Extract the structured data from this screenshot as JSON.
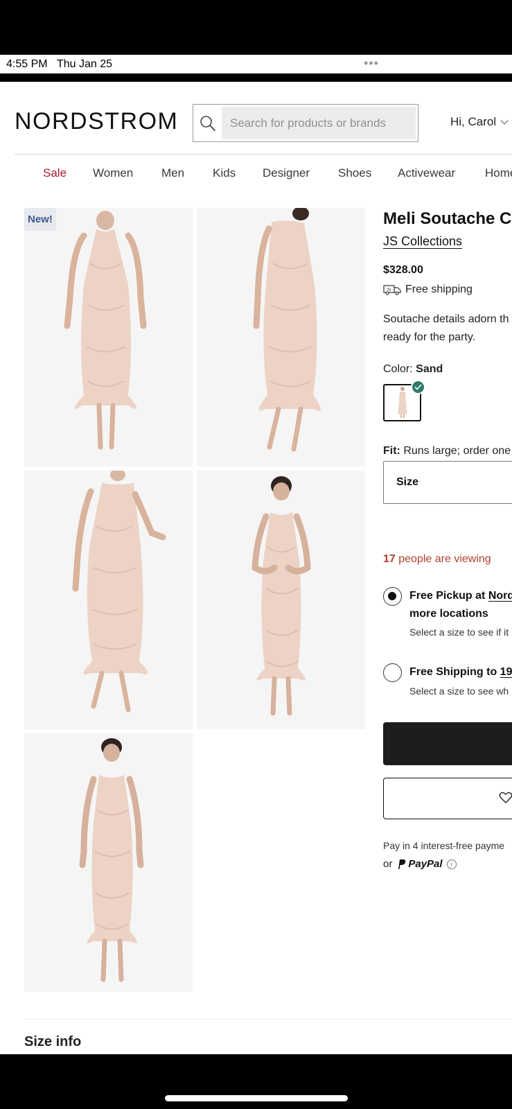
{
  "status_bar": {
    "time": "4:55 PM",
    "date": "Thu Jan 25",
    "dots": "•••"
  },
  "header": {
    "logo": "NORDSTROM",
    "search_placeholder": "Search for products or brands",
    "account_label": "Hi, Carol"
  },
  "nav": {
    "items": [
      "Sale",
      "Women",
      "Men",
      "Kids",
      "Designer",
      "Shoes",
      "Activewear",
      "Home"
    ]
  },
  "gallery": {
    "badge": "New!",
    "image_count": 5,
    "dress_color": "#ecd3c6"
  },
  "product": {
    "title": "Meli Soutache C",
    "brand": "JS Collections",
    "price": "$328.00",
    "shipping": "Free shipping",
    "description_line1": "Soutache details adorn th",
    "description_line2": "ready for the party.",
    "color_label": "Color:",
    "color_value": "Sand",
    "fit_label": "Fit:",
    "fit_value": "Runs large; order one",
    "size_label": "Size",
    "viewing_count": "17",
    "viewing_text": "people are viewing",
    "pickup_title_prefix": "Free Pickup at ",
    "pickup_store": "Nord",
    "pickup_title_line2": "more locations",
    "pickup_sub": "Select a size to see if it",
    "ship_title_prefix": "Free Shipping to ",
    "ship_zip": "19",
    "ship_sub": "Select a size to see wh",
    "pay_later": "Pay in 4 interest-free payme",
    "paypal_prefix": "or",
    "paypal_label": "PayPal"
  },
  "footer_section": {
    "title": "Size info"
  },
  "colors": {
    "sale": "#a6192e",
    "viewing": "#b0412e",
    "check": "#2e7d6b",
    "primary_button": "#1b1d1f"
  }
}
